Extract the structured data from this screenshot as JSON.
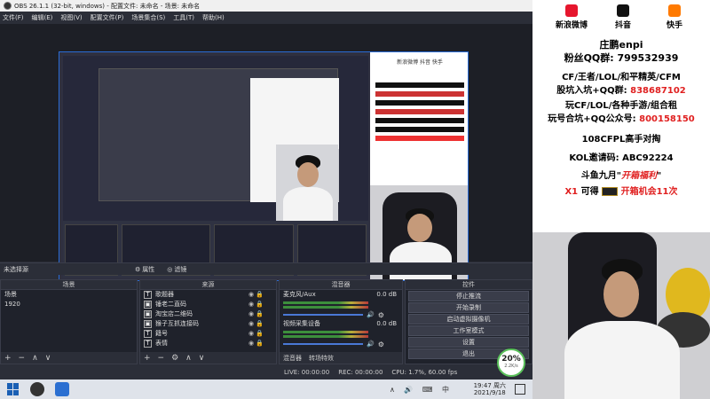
{
  "window": {
    "title": "OBS 26.1.1 (32-bit, windows) - 配置文件: 未命名 - 场景: 未命名"
  },
  "menu": [
    "文件(F)",
    "编辑(E)",
    "视图(V)",
    "配置文件(P)",
    "场景集合(S)",
    "工具(T)",
    "帮助(H)"
  ],
  "dockbar": {
    "source_label": "未选择源",
    "props": "属性",
    "filters": "滤镜"
  },
  "scenes": {
    "header": "场景",
    "items": [
      "场景",
      "1920"
    ]
  },
  "sources": {
    "header": "来源",
    "items": [
      {
        "icon": "T",
        "label": "歌题器"
      },
      {
        "icon": "▣",
        "label": "锤老二直码"
      },
      {
        "icon": "▣",
        "label": "淘宝店二维码"
      },
      {
        "icon": "▣",
        "label": "猴子互抓连接码"
      },
      {
        "icon": "T",
        "label": "籍号"
      },
      {
        "icon": "T",
        "label": "表情"
      }
    ]
  },
  "mixer": {
    "header": "混音器",
    "ch1": {
      "name": "麦克风/Aux",
      "db": "0.0 dB"
    },
    "ch2": {
      "name": "视频采集设备",
      "db": "0.0 dB"
    },
    "tabs": [
      "混音器",
      "转场特效"
    ]
  },
  "controls": {
    "header": "控件",
    "buttons": [
      "停止推流",
      "开始录制",
      "启动虚拟摄像机",
      "工作室模式",
      "设置",
      "退出"
    ]
  },
  "status": {
    "live": "LIVE: 00:00:00",
    "rec": "REC: 00:00:00",
    "cpu": "CPU: 1.7%, 60.00 fps"
  },
  "cpu_badge": {
    "percent": "20%",
    "rate": "2.2K/s"
  },
  "taskbar": {
    "time": "19:47 周六",
    "date": "2021/9/18",
    "ime": "中"
  },
  "overlay": {
    "socials": [
      {
        "label": "新浪微博",
        "color": "#e6162d"
      },
      {
        "label": "抖音",
        "color": "#111111"
      },
      {
        "label": "快手",
        "color": "#ff7a00"
      }
    ],
    "name": "庄鹏enpi",
    "qq": "粉丝QQ群: 799532939",
    "line1": "CF/王者/LOL/和平精英/CFM",
    "line2a": "股坑入坑+QQ群: ",
    "line2b": "838687102",
    "line3": "玩CF/LOL/各种手游/组合租",
    "line4a": "玩号合坑+QQ公众号: ",
    "line4b": "800158150",
    "line5": "108CFPL高手对掏",
    "line6": "KOL邀请码: ABC92224",
    "line7a": "斗鱼九月\"",
    "line7b": "开箱福利",
    "line7c": "\"",
    "line8a": "X1",
    "line8b": "可得",
    "line8c": "开箱机会11次"
  }
}
